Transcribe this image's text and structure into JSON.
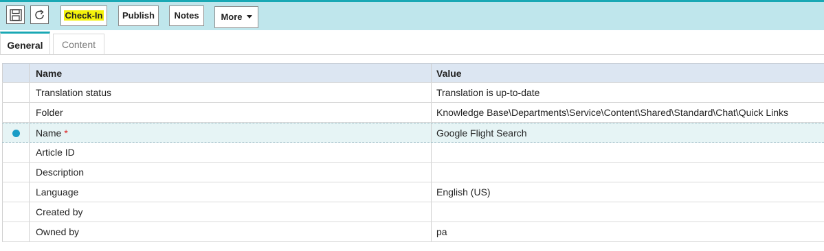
{
  "toolbar": {
    "save_icon": "save-icon",
    "refresh_icon": "refresh-icon",
    "checkin_label": "Check-In",
    "publish_label": "Publish",
    "notes_label": "Notes",
    "more_label": "More",
    "highlight_color": "#f4f20c",
    "accent_color": "#19a8b4"
  },
  "tabs": [
    {
      "label": "General",
      "active": true
    },
    {
      "label": "Content",
      "active": false
    }
  ],
  "grid": {
    "columns": {
      "name": "Name",
      "value": "Value"
    },
    "rows": [
      {
        "name": "Translation status",
        "value": "Translation is up-to-date"
      },
      {
        "name": "Folder",
        "value": "Knowledge Base\\Departments\\Service\\Content\\Shared\\Standard\\Chat\\Quick Links"
      },
      {
        "name": "Name",
        "required_mark": "*",
        "value": "Google Flight Search",
        "selected": true
      },
      {
        "name": "Article ID",
        "value": ""
      },
      {
        "name": "Description",
        "value": ""
      },
      {
        "name": "Language",
        "value": "English (US)"
      },
      {
        "name": "Created by",
        "value": ""
      },
      {
        "name": "Owned by",
        "value": "pa"
      }
    ]
  }
}
